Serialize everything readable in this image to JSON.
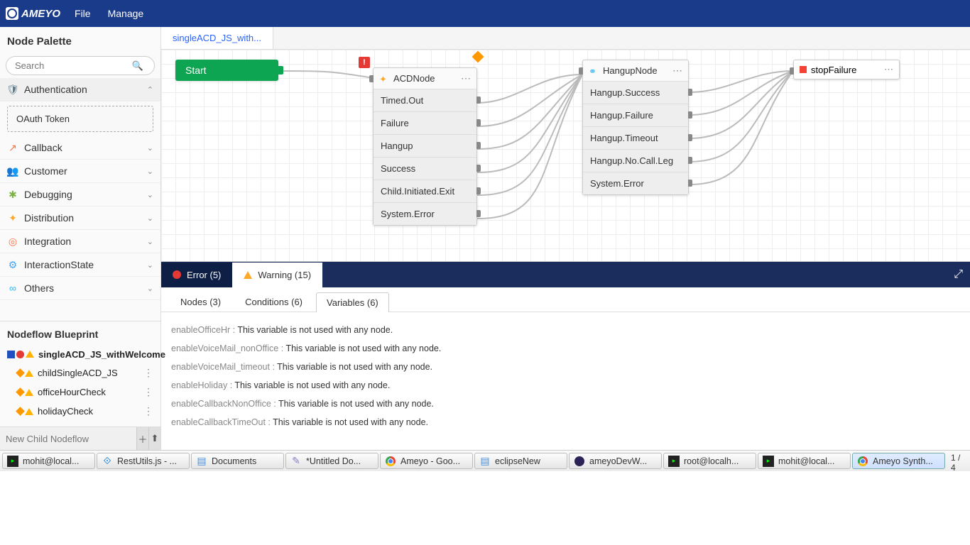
{
  "app": {
    "brand": "AMEYO",
    "menu": [
      "File",
      "Manage"
    ]
  },
  "palette": {
    "title": "Node Palette",
    "search_placeholder": "Search",
    "categories": [
      {
        "label": "Authentication",
        "icon": "🛡",
        "iconColor": "#607d8b",
        "expanded": true,
        "sub": [
          "OAuth Token"
        ]
      },
      {
        "label": "Callback",
        "icon": "↗",
        "iconColor": "#ff7043"
      },
      {
        "label": "Customer",
        "icon": "👥",
        "iconColor": "#5c6bc0"
      },
      {
        "label": "Debugging",
        "icon": "✱",
        "iconColor": "#7cb342"
      },
      {
        "label": "Distribution",
        "icon": "✦",
        "iconColor": "#ffa726"
      },
      {
        "label": "Integration",
        "icon": "◎",
        "iconColor": "#ff7043"
      },
      {
        "label": "InteractionState",
        "icon": "⚙",
        "iconColor": "#42a5f5"
      },
      {
        "label": "Others",
        "icon": "∞",
        "iconColor": "#29b6f6"
      }
    ]
  },
  "blueprint": {
    "title": "Nodeflow Blueprint",
    "root": "singleACD_JS_withWelcome",
    "children": [
      {
        "label": "childSingleACD_JS"
      },
      {
        "label": "officeHourCheck"
      },
      {
        "label": "holidayCheck"
      }
    ],
    "new_placeholder": "New Child Nodeflow"
  },
  "tab": {
    "label": "singleACD_JS_with..."
  },
  "nodes": {
    "start": "Start",
    "acd": {
      "title": "ACDNode",
      "outputs": [
        "Timed.Out",
        "Failure",
        "Hangup",
        "Success",
        "Child.Initiated.Exit",
        "System.Error"
      ]
    },
    "hangup": {
      "title": "HangupNode",
      "outputs": [
        "Hangup.Success",
        "Hangup.Failure",
        "Hangup.Timeout",
        "Hangup.No.Call.Leg",
        "System.Error"
      ]
    },
    "stop": {
      "title": "stopFailure"
    }
  },
  "issues": {
    "error_tab": "Error (5)",
    "warning_tab": "Warning (15)",
    "subtabs": [
      "Nodes (3)",
      "Conditions (6)",
      "Variables (6)"
    ],
    "active_subtab": 2,
    "list": [
      {
        "var": "enableOfficeHr : ",
        "msg": "This variable is not used with any node."
      },
      {
        "var": "enableVoiceMail_nonOffice : ",
        "msg": "This variable is not used with any node."
      },
      {
        "var": "enableVoiceMail_timeout : ",
        "msg": "This variable is not used with any node."
      },
      {
        "var": "enableHoliday : ",
        "msg": "This variable is not used with any node."
      },
      {
        "var": "enableCallbackNonOffice : ",
        "msg": "This variable is not used with any node."
      },
      {
        "var": "enableCallbackTimeOut : ",
        "msg": "This variable is not used with any node."
      }
    ]
  },
  "taskbar": {
    "items": [
      {
        "label": "mohit@local...",
        "icon": "term"
      },
      {
        "label": "RestUtils.js - ...",
        "icon": "vscode"
      },
      {
        "label": "Documents",
        "icon": "files"
      },
      {
        "label": "*Untitled Do...",
        "icon": "editor"
      },
      {
        "label": "Ameyo - Goo...",
        "icon": "chrome"
      },
      {
        "label": "eclipseNew",
        "icon": "files"
      },
      {
        "label": "ameyoDevW...",
        "icon": "eclipse"
      },
      {
        "label": "root@localh...",
        "icon": "term"
      },
      {
        "label": "mohit@local...",
        "icon": "term"
      },
      {
        "label": "Ameyo Synth...",
        "icon": "chrome",
        "active": true
      }
    ],
    "count": "1 / 4"
  }
}
